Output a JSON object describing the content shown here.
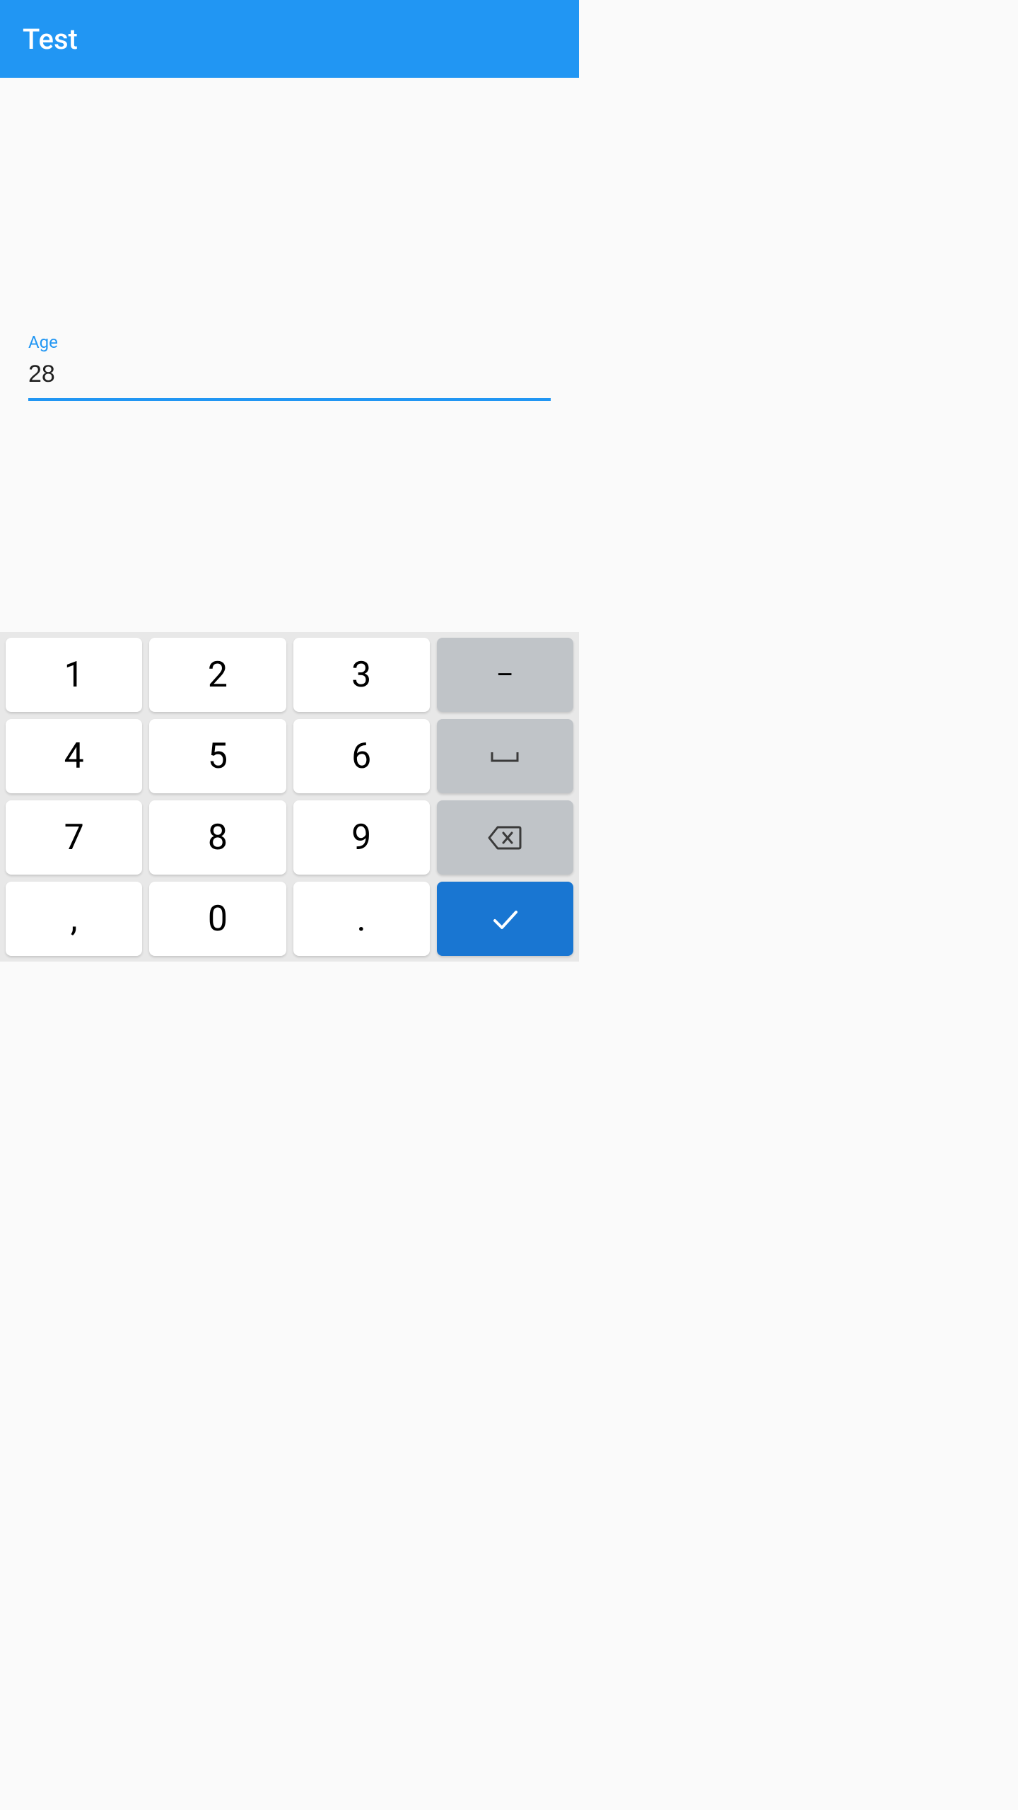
{
  "header": {
    "title": "Test"
  },
  "form": {
    "age": {
      "label": "Age",
      "value": "28"
    }
  },
  "keyboard": {
    "keys": {
      "k1": "1",
      "k2": "2",
      "k3": "3",
      "k4": "4",
      "k5": "5",
      "k6": "6",
      "k7": "7",
      "k8": "8",
      "k9": "9",
      "k0": "0",
      "comma": ",",
      "period": ".",
      "minus": "–",
      "space": "␣"
    }
  }
}
